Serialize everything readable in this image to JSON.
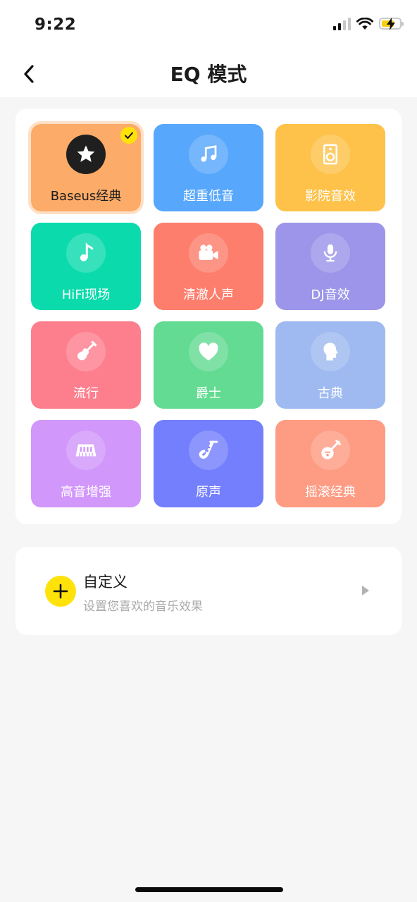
{
  "status_bar": {
    "time": "9:22"
  },
  "header": {
    "title": "EQ 模式"
  },
  "modes": [
    {
      "label": "Baseus经典",
      "icon": "star-icon",
      "color": "#fcab68",
      "selected": true
    },
    {
      "label": "超重低音",
      "icon": "music-note-icon",
      "color": "#57a7fc",
      "selected": false
    },
    {
      "label": "影院音效",
      "icon": "speaker-icon",
      "color": "#fec24a",
      "selected": false
    },
    {
      "label": "HiFi现场",
      "icon": "single-note-icon",
      "color": "#0bdbac",
      "selected": false
    },
    {
      "label": "清澈人声",
      "icon": "video-camera-icon",
      "color": "#fd7e6c",
      "selected": false
    },
    {
      "label": "DJ音效",
      "icon": "microphone-icon",
      "color": "#9c95e9",
      "selected": false
    },
    {
      "label": "流行",
      "icon": "guitar-icon",
      "color": "#fd7f8e",
      "selected": false
    },
    {
      "label": "爵士",
      "icon": "heart-icon",
      "color": "#63db92",
      "selected": false
    },
    {
      "label": "古典",
      "icon": "head-silhouette-icon",
      "color": "#9ebaf0",
      "selected": false
    },
    {
      "label": "高音增强",
      "icon": "piano-keys-icon",
      "color": "#d197fb",
      "selected": false
    },
    {
      "label": "原声",
      "icon": "saxophone-icon",
      "color": "#747ffd",
      "selected": false
    },
    {
      "label": "摇滚经典",
      "icon": "banjo-icon",
      "color": "#fe9b83",
      "selected": false
    }
  ],
  "custom": {
    "title": "自定义",
    "subtitle": "设置您喜欢的音乐效果"
  },
  "colors": {
    "accent": "#ffe20a",
    "background": "#f6f6f6"
  }
}
